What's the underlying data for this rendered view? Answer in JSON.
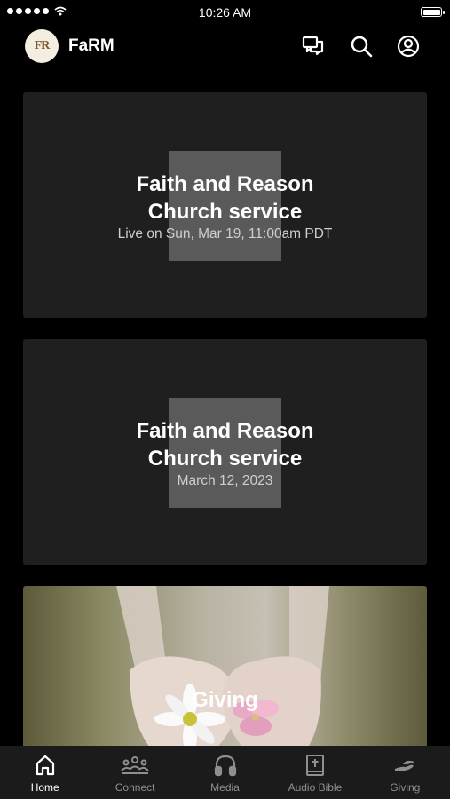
{
  "status_bar": {
    "time": "10:26 AM"
  },
  "header": {
    "avatar_text": "FR",
    "title": "FaRM",
    "icons": [
      "chat-icon",
      "search-icon",
      "account-icon"
    ]
  },
  "cards": [
    {
      "title_line1": "Faith and Reason",
      "title_line2": "Church service",
      "subtitle": "Live on Sun, Mar 19, 11:00am PDT"
    },
    {
      "title_line1": "Faith and Reason",
      "title_line2": "Church service",
      "subtitle": "March 12, 2023"
    }
  ],
  "giving_card": {
    "label": "Giving"
  },
  "tabs": [
    {
      "label": "Home",
      "icon": "home-icon",
      "active": true
    },
    {
      "label": "Connect",
      "icon": "people-icon",
      "active": false
    },
    {
      "label": "Media",
      "icon": "headphones-icon",
      "active": false
    },
    {
      "label": "Audio Bible",
      "icon": "bible-icon",
      "active": false
    },
    {
      "label": "Giving",
      "icon": "giving-hand-icon",
      "active": false
    }
  ],
  "colors": {
    "background": "#000000",
    "card": "#1f1f1f",
    "tab_bar": "#1b1b1b",
    "inactive_tab": "#8f8f8f"
  }
}
